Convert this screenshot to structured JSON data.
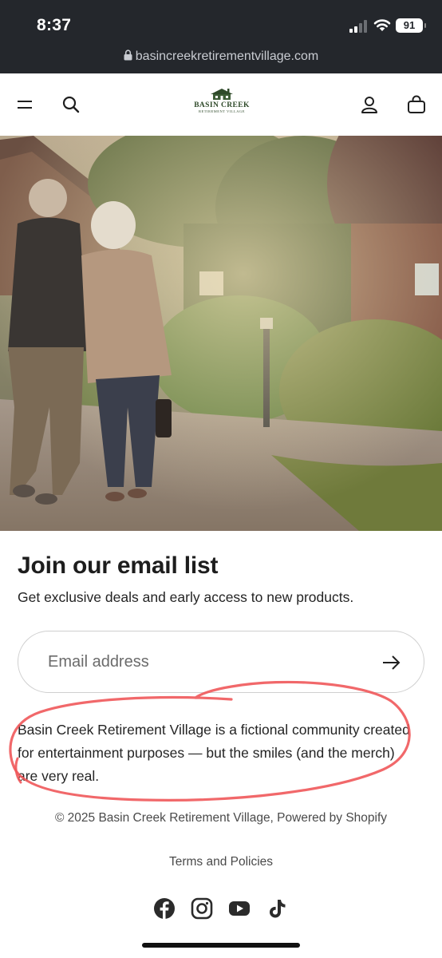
{
  "status_bar": {
    "time": "8:37",
    "battery": "91"
  },
  "browser": {
    "url": "basincreekretirementvillage.com"
  },
  "header": {
    "logo_title": "BASIN CREEK",
    "logo_subtitle": "RETIREMENT VILLAGE",
    "icons": [
      "menu-icon",
      "search-icon",
      "account-icon",
      "cart-icon"
    ]
  },
  "newsletter": {
    "title": "Join our email list",
    "subtitle": "Get exclusive deals and early access to new products.",
    "email_placeholder": "Email address"
  },
  "disclaimer": "Basin Creek Retirement Village is a fictional community created for entertainment purposes — but the smiles (and the merch) are very real.",
  "footer": {
    "copyright": "© 2025 Basin Creek Retirement Village, Powered by Shopify",
    "terms": "Terms and Policies",
    "social": [
      "facebook-icon",
      "instagram-icon",
      "youtube-icon",
      "tiktok-icon"
    ]
  },
  "colors": {
    "status_bar": "#24272c",
    "brand_green": "#2f4a2a",
    "annotation": "#f0585a"
  }
}
